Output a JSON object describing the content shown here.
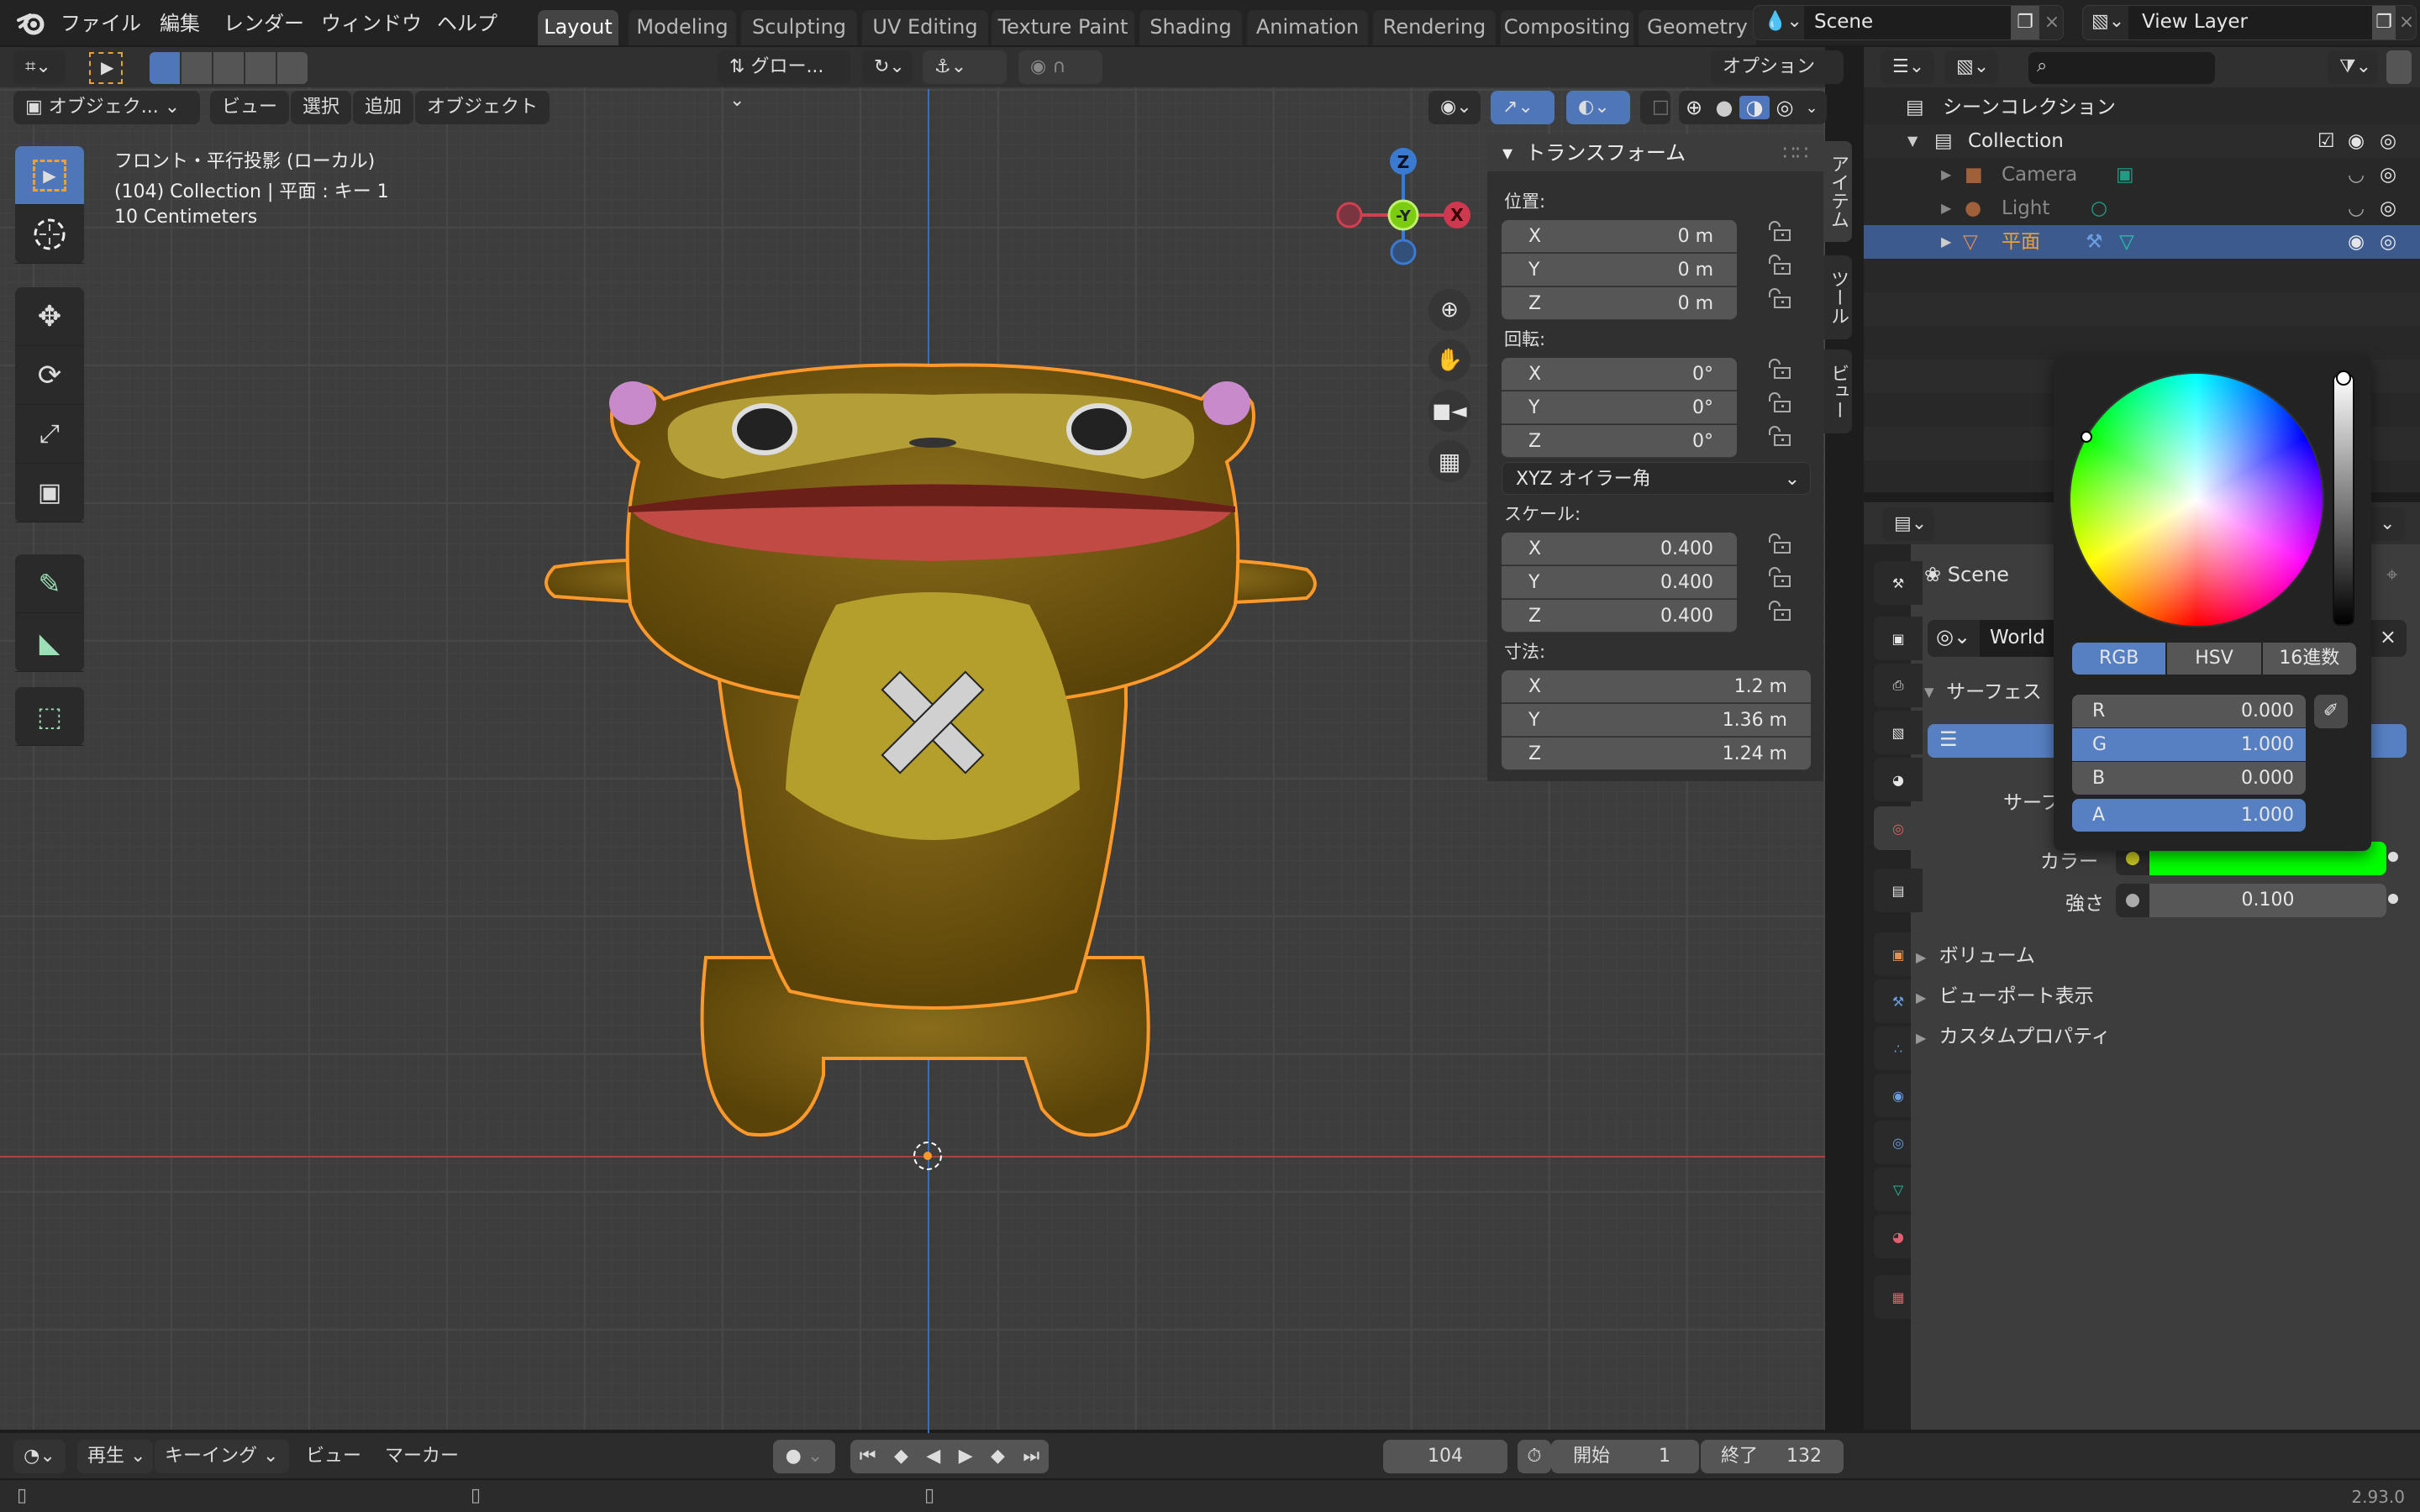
{
  "menu": {
    "items": [
      "ファイル",
      "編集",
      "レンダー",
      "ウィンドウ",
      "ヘルプ"
    ]
  },
  "workspaces": {
    "active": "Layout",
    "tabs": [
      "Layout",
      "Modeling",
      "Sculpting",
      "UV Editing",
      "Texture Paint",
      "Shading",
      "Animation",
      "Rendering",
      "Compositing",
      "Geometry"
    ]
  },
  "scene_selector": {
    "value": "Scene"
  },
  "view_layer_selector": {
    "value": "View Layer"
  },
  "viewport_header": {
    "transform_orientation": "グロー...",
    "options": "オプション",
    "mode": "オブジェク...",
    "menus": [
      "ビュー",
      "選択",
      "追加",
      "オブジェクト"
    ]
  },
  "viewport_overlay": {
    "view_name": "フロント・平行投影 (ローカル)",
    "object_info": "(104) Collection | 平面 : キー 1",
    "grid_scale": "10 Centimeters"
  },
  "gizmo": {
    "z": "Z",
    "y": "-Y",
    "x": "X"
  },
  "sidebar_tabs": [
    "アイテム",
    "ツール",
    "ビュー"
  ],
  "transform_panel": {
    "title": "トランスフォーム",
    "location": {
      "label": "位置:",
      "x": "0 m",
      "y": "0 m",
      "z": "0 m"
    },
    "rotation": {
      "label": "回転:",
      "x": "0°",
      "y": "0°",
      "z": "0°"
    },
    "rotation_mode": "XYZ オイラー角",
    "scale": {
      "label": "スケール:",
      "x": "0.400",
      "y": "0.400",
      "z": "0.400"
    },
    "dimensions": {
      "label": "寸法:",
      "x": "1.2 m",
      "y": "1.36 m",
      "z": "1.24 m"
    },
    "axis_labels": {
      "x": "X",
      "y": "Y",
      "z": "Z"
    }
  },
  "outliner": {
    "root": "シーンコレクション",
    "collection": "Collection",
    "items": [
      {
        "name": "Camera",
        "selected": false
      },
      {
        "name": "Light",
        "selected": false
      },
      {
        "name": "平面",
        "selected": true
      }
    ]
  },
  "properties": {
    "breadcrumb_scene": "Scene",
    "world_name": "World",
    "surface_panel": "サーフェス",
    "surface_label": "サーフェ",
    "color_label": "カラー",
    "color_value": "#00ff00",
    "strength_label": "強さ",
    "strength_value": "0.100",
    "collapsed_panels": [
      "ボリューム",
      "ビューポート表示",
      "カスタムプロパティ"
    ]
  },
  "color_picker": {
    "modes": [
      "RGB",
      "HSV",
      "16進数"
    ],
    "active_mode": "RGB",
    "r": {
      "label": "R",
      "value": "0.000"
    },
    "g": {
      "label": "G",
      "value": "1.000"
    },
    "b": {
      "label": "B",
      "value": "0.000"
    },
    "a": {
      "label": "A",
      "value": "1.000"
    },
    "value_slider": 1.0
  },
  "timeline": {
    "menus": [
      "再生",
      "キーイング",
      "ビュー",
      "マーカー"
    ],
    "current_frame": "104",
    "start_label": "開始",
    "start_value": "1",
    "end_label": "終了",
    "end_value": "132"
  },
  "status": {
    "version": "2.93.0"
  }
}
